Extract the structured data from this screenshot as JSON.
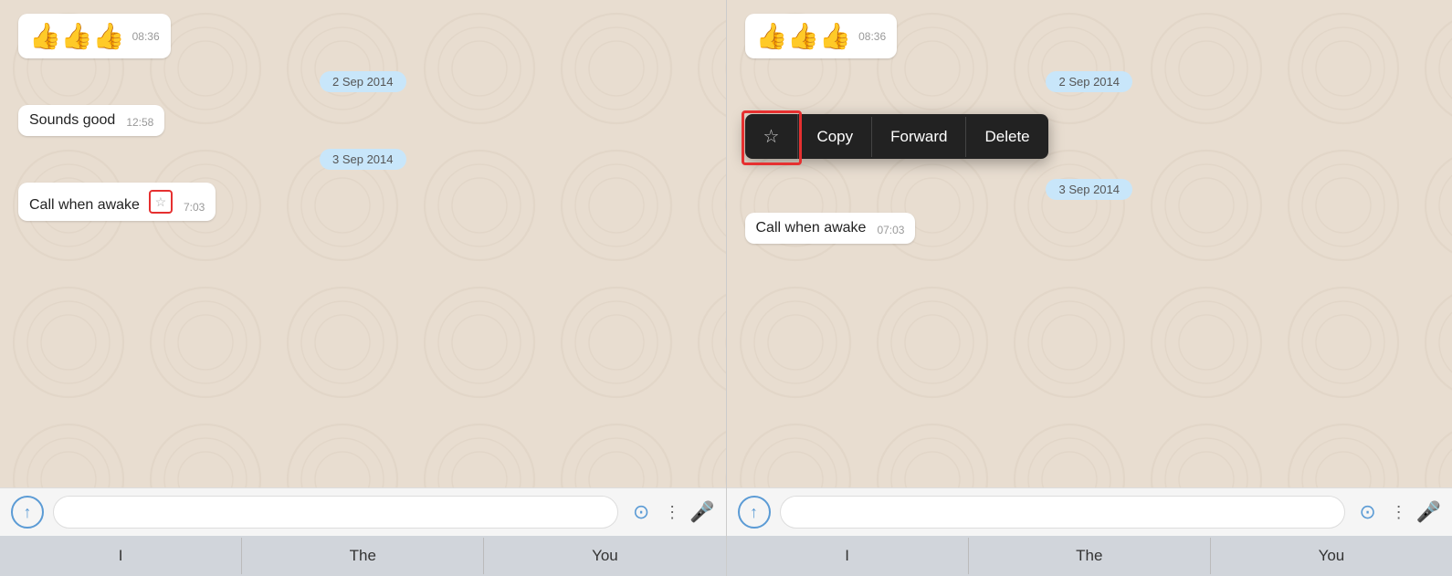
{
  "panels": [
    {
      "id": "left",
      "messages": [
        {
          "type": "emoji",
          "emoji": "👍👍👍",
          "time": "08:36"
        },
        {
          "type": "date",
          "label": "2 Sep 2014"
        },
        {
          "type": "text",
          "content": "Sounds good",
          "time": "12:58"
        },
        {
          "type": "date",
          "label": "3 Sep 2014"
        },
        {
          "type": "text-star",
          "content": "Call when awake",
          "time": "7:03"
        }
      ],
      "input": {
        "placeholder": ""
      },
      "keyboard": [
        "I",
        "The",
        "You"
      ]
    },
    {
      "id": "right",
      "messages": [
        {
          "type": "emoji",
          "emoji": "👍👍👍",
          "time": "08:36"
        },
        {
          "type": "date",
          "label": "2 Sep 2014"
        },
        {
          "type": "date",
          "label": "3 Sep 2014"
        },
        {
          "type": "text",
          "content": "Call when awake",
          "time": "07:03"
        }
      ],
      "contextMenu": {
        "items": [
          "☆",
          "Copy",
          "Forward",
          "Delete"
        ]
      },
      "input": {
        "placeholder": ""
      },
      "keyboard": [
        "I",
        "The",
        "You"
      ]
    }
  ]
}
